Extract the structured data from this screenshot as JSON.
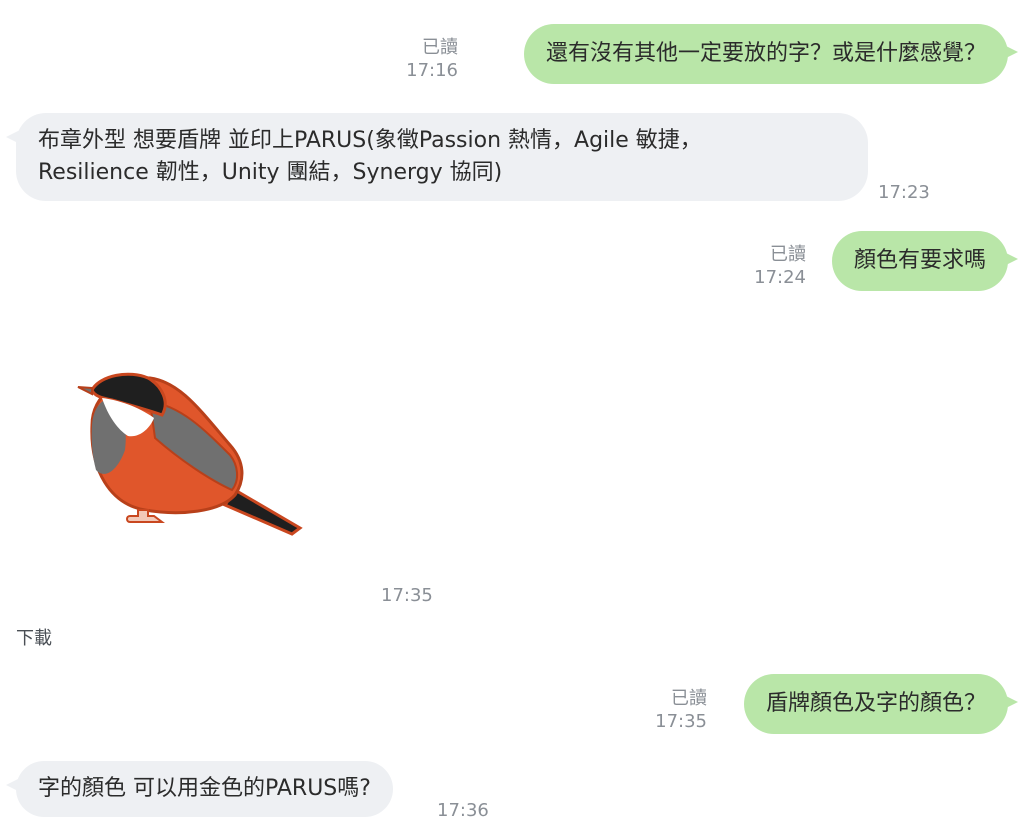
{
  "messages": [
    {
      "direction": "out",
      "text": "還有沒有其他一定要放的字？或是什麼感覺？",
      "read": "已讀",
      "time": "17:16"
    },
    {
      "direction": "in",
      "text_lines": [
        "布章外型 想要盾牌 並印上PARUS(象徵Passion 熱情，Agile 敏捷，",
        "Resilience 韌性，Unity 團結，Synergy 協同)"
      ],
      "time": "17:23"
    },
    {
      "direction": "out",
      "text": "顏色有要求嗎",
      "read": "已讀",
      "time": "17:24"
    },
    {
      "direction": "in",
      "type": "image",
      "image_subject": "bird-illustration",
      "time": "17:35",
      "download": "下載"
    },
    {
      "direction": "out",
      "text": "盾牌顏色及字的顏色？",
      "read": "已讀",
      "time": "17:35"
    },
    {
      "direction": "in",
      "text": "字的顏色 可以用金色的PARUS嗎?",
      "time": "17:36"
    }
  ],
  "colors": {
    "outgoing_bubble": "#b9e6a8",
    "incoming_bubble": "#eef0f3",
    "meta_text": "#8a8f96",
    "bird_breast": "#e0562b",
    "bird_wing": "#707070",
    "bird_head": "#1f1f1f"
  }
}
